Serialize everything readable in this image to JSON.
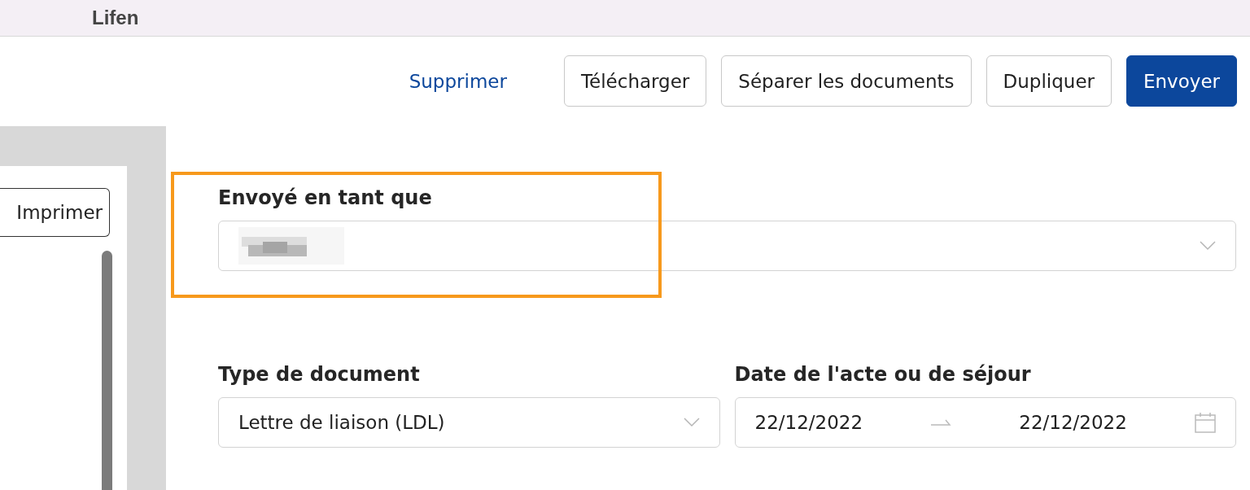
{
  "header": {
    "title": "Lifen"
  },
  "toolbar": [
    {
      "label": "Supprimer",
      "kind": "link"
    },
    {
      "label": "Télécharger",
      "kind": "secondary"
    },
    {
      "label": "Séparer les documents",
      "kind": "secondary"
    },
    {
      "label": "Dupliquer",
      "kind": "secondary"
    },
    {
      "label": "Envoyer",
      "kind": "primary"
    }
  ],
  "preview": {
    "print_button": "Imprimer"
  },
  "sender": {
    "label": "Envoyé en tant que",
    "highlighted": true,
    "redacted": true
  },
  "document_type": {
    "label": "Type de document",
    "value": "Lettre de liaison (LDL)"
  },
  "date": {
    "label": "Date de l'acte ou de séjour",
    "start": "22/12/2022",
    "end": "22/12/2022"
  }
}
